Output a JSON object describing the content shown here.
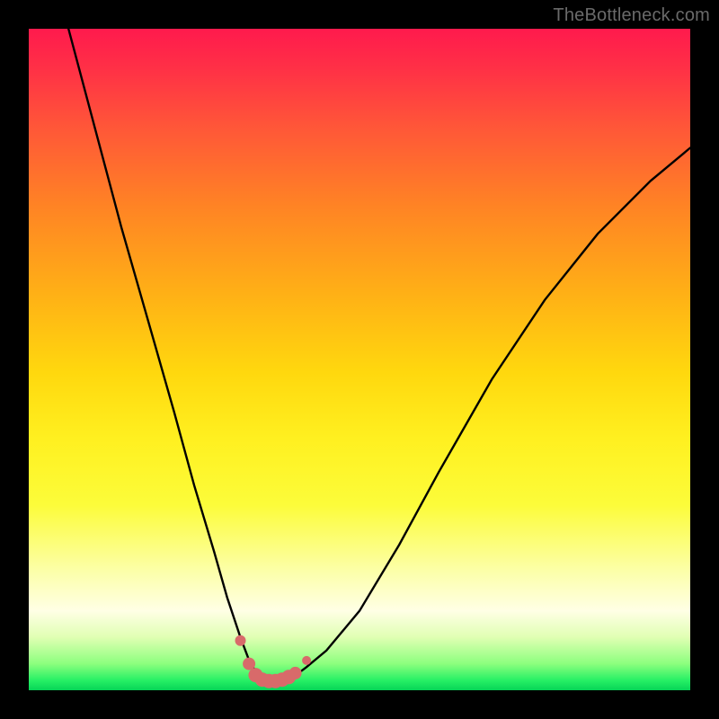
{
  "watermark": "TheBottleneck.com",
  "chart_data": {
    "type": "line",
    "title": "",
    "xlabel": "",
    "ylabel": "",
    "xlim": [
      0,
      100
    ],
    "ylim": [
      0,
      100
    ],
    "series": [
      {
        "name": "bottleneck-curve",
        "x": [
          6,
          10,
          14,
          18,
          22,
          25,
          28,
          30,
          32,
          33.5,
          35,
          36.5,
          38,
          40,
          42,
          45,
          50,
          56,
          62,
          70,
          78,
          86,
          94,
          100
        ],
        "values": [
          100,
          85,
          70,
          56,
          42,
          31,
          21,
          14,
          8,
          4,
          2,
          1.5,
          1.5,
          2,
          3.5,
          6,
          12,
          22,
          33,
          47,
          59,
          69,
          77,
          82
        ]
      }
    ],
    "markers": {
      "name": "highlight-dots",
      "color": "#d86a6a",
      "points": [
        {
          "x": 32.0,
          "y": 7.5,
          "r": 6
        },
        {
          "x": 33.3,
          "y": 4.0,
          "r": 7
        },
        {
          "x": 34.3,
          "y": 2.3,
          "r": 8
        },
        {
          "x": 35.3,
          "y": 1.6,
          "r": 8
        },
        {
          "x": 36.3,
          "y": 1.4,
          "r": 8
        },
        {
          "x": 37.3,
          "y": 1.4,
          "r": 8
        },
        {
          "x": 38.3,
          "y": 1.6,
          "r": 8
        },
        {
          "x": 39.3,
          "y": 2.0,
          "r": 8
        },
        {
          "x": 40.3,
          "y": 2.6,
          "r": 7
        },
        {
          "x": 42.0,
          "y": 4.5,
          "r": 5
        }
      ]
    }
  }
}
